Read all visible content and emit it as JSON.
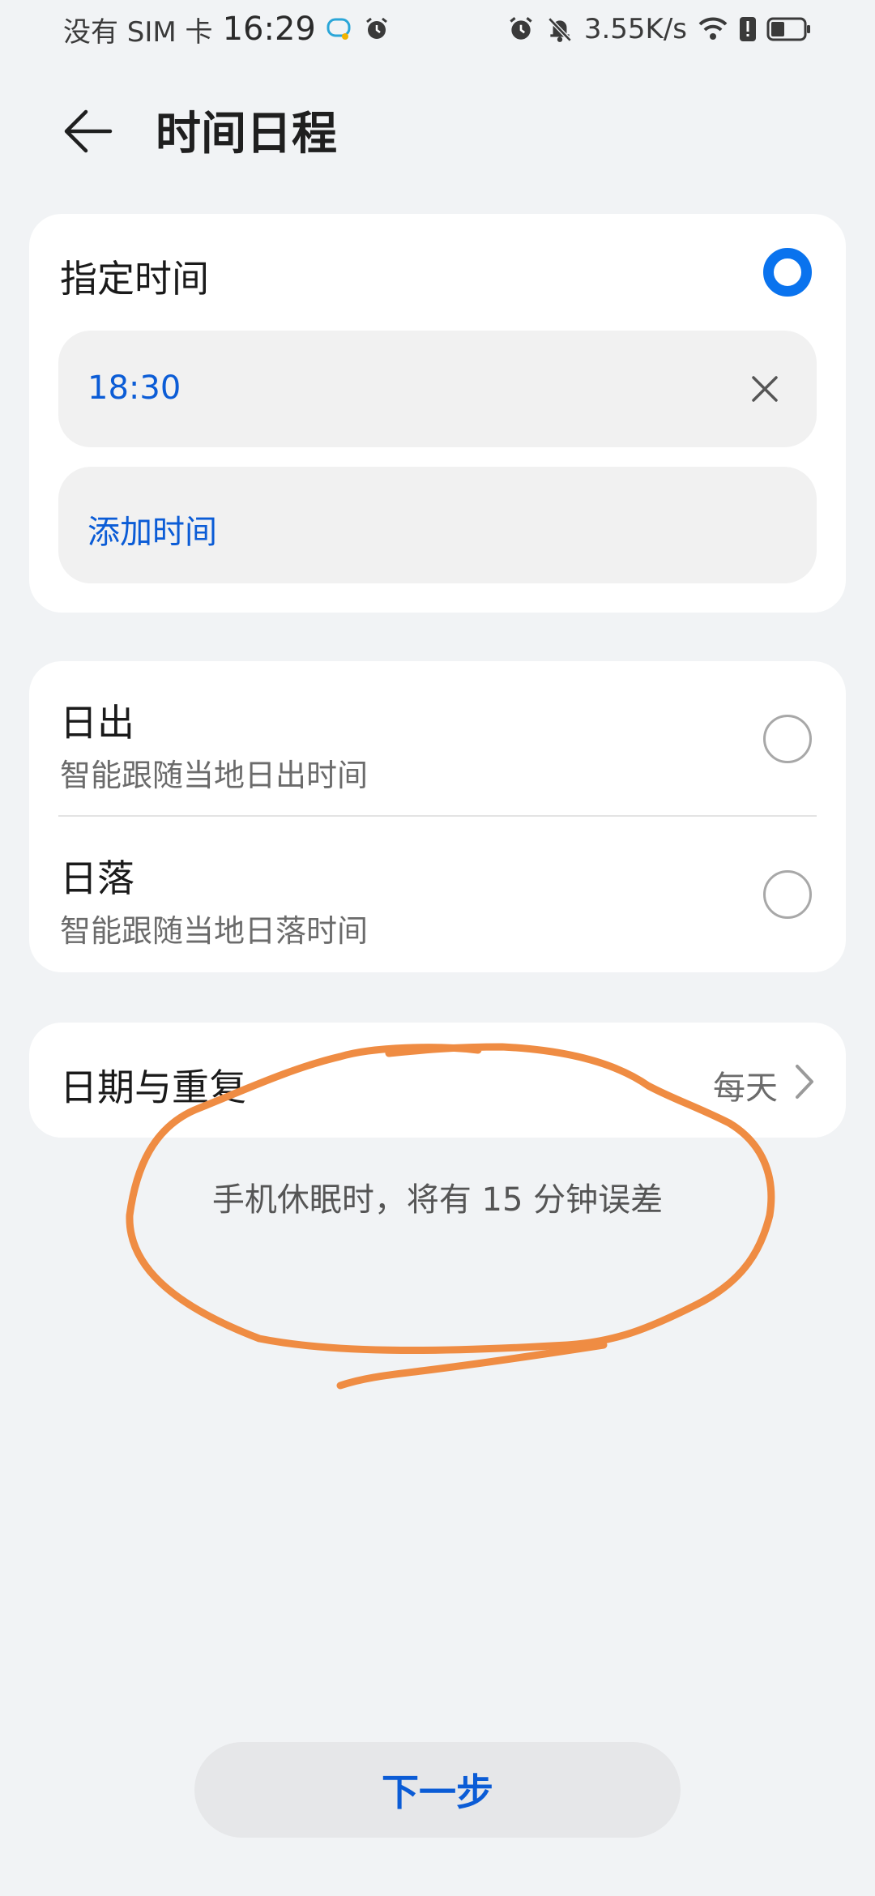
{
  "status_bar": {
    "carrier": "没有 SIM 卡",
    "time": "16:29",
    "net_speed": "3.55K/s",
    "icons_left": [
      "chat-notification-icon",
      "alarm-icon"
    ],
    "icons_right": [
      "alarm-icon",
      "mute-icon",
      "wifi-icon",
      "alert-icon",
      "battery-icon"
    ]
  },
  "header": {
    "back_icon": "back-arrow-icon",
    "title": "时间日程"
  },
  "specified_time": {
    "title": "指定时间",
    "selected": true,
    "times": [
      {
        "value": "18:30",
        "remove_icon": "close-icon"
      }
    ],
    "add_label": "添加时间"
  },
  "sun_options": [
    {
      "title": "日出",
      "subtitle": "智能跟随当地日出时间",
      "selected": false
    },
    {
      "title": "日落",
      "subtitle": "智能跟随当地日落时间",
      "selected": false
    }
  ],
  "date_repeat": {
    "title": "日期与重复",
    "value": "每天",
    "chevron_icon": "chevron-right-icon"
  },
  "hint": "手机休眠时，将有 15 分钟误差",
  "next_button": "下一步",
  "colors": {
    "accent": "#0a73ee",
    "link": "#0b5cd6",
    "annotation": "#ef8c43",
    "background": "#f1f3f5"
  }
}
